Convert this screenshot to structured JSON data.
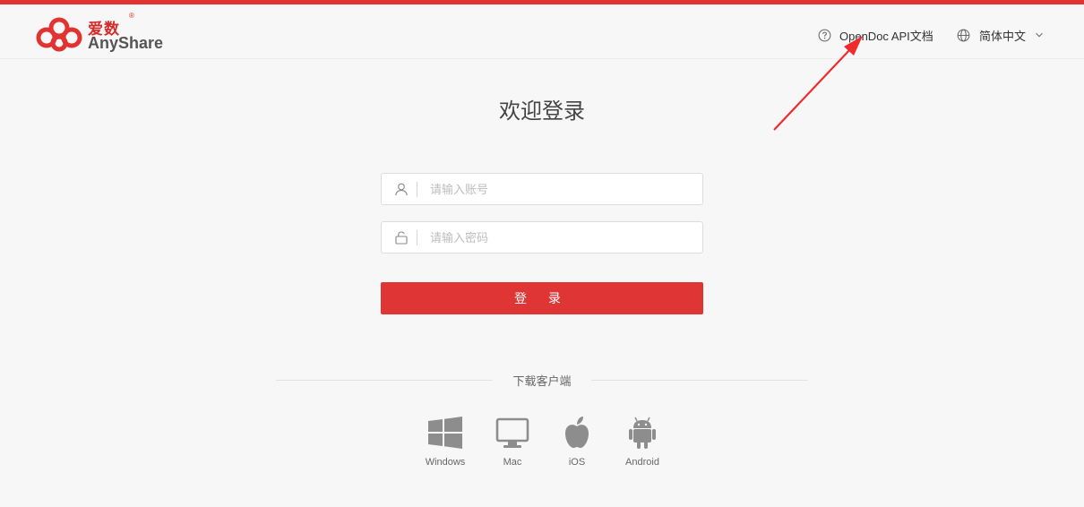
{
  "brand": {
    "name_cn": "爱数",
    "name_en": "AnyShare",
    "registered_mark": "®",
    "color": "#e23333"
  },
  "header": {
    "doc_link_label": "OpenDoc API文档",
    "doc_link_icon": "question-circle-icon",
    "language_label": "简体中文",
    "language_icon": "globe-icon"
  },
  "login": {
    "title": "欢迎登录",
    "account_placeholder": "请输入账号",
    "account_icon": "user-icon",
    "password_placeholder": "请输入密码",
    "password_icon": "lock-icon",
    "submit_label": "登 录",
    "button_color": "#e03535"
  },
  "download": {
    "title": "下载客户端",
    "clients": [
      {
        "label": "Windows",
        "icon": "windows-icon"
      },
      {
        "label": "Mac",
        "icon": "monitor-icon"
      },
      {
        "label": "iOS",
        "icon": "apple-icon"
      },
      {
        "label": "Android",
        "icon": "android-icon"
      }
    ]
  }
}
